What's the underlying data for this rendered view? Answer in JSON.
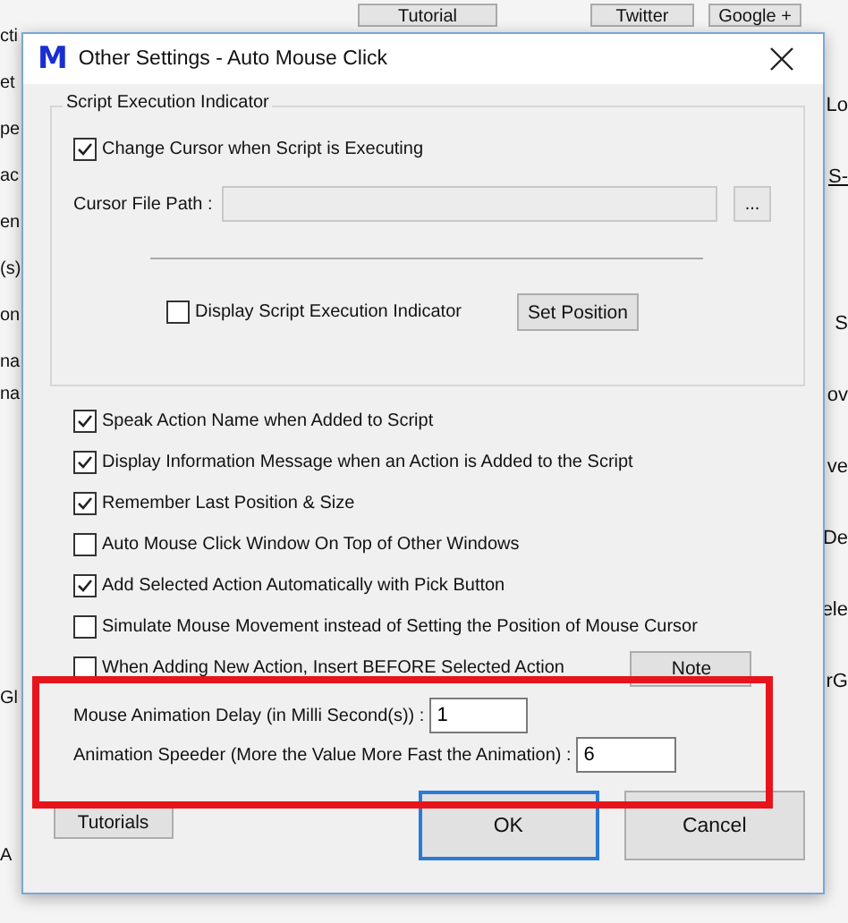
{
  "background": {
    "buttons": [
      "Tutorial",
      "Twitter",
      "Google +"
    ],
    "left_fragments": [
      "cti",
      "et",
      "pe",
      "ac",
      "en",
      "(s)",
      "on",
      "na",
      "na",
      "Gl",
      "A"
    ],
    "right_fragments": [
      "Lo",
      "S-",
      "S",
      "ov",
      "ve",
      "De",
      "ele",
      "rG"
    ]
  },
  "dialog": {
    "logo": "M",
    "title": "Other Settings - Auto Mouse Click",
    "group": {
      "title": "Script Execution Indicator",
      "change_cursor": {
        "label": "Change Cursor when Script is Executing",
        "checked": true
      },
      "cursor_path": {
        "label": "Cursor File Path :",
        "browse": "..."
      },
      "display_indicator": {
        "label": "Display Script Execution Indicator",
        "checked": false
      },
      "set_position": "Set Position"
    },
    "options": [
      {
        "label": "Speak Action Name when Added to Script",
        "checked": true
      },
      {
        "label": "Display Information Message when an Action is Added to the Script",
        "checked": true
      },
      {
        "label": "Remember Last Position & Size",
        "checked": true
      },
      {
        "label": "Auto Mouse Click Window On Top of Other Windows",
        "checked": false
      },
      {
        "label": "Add Selected Action Automatically with Pick Button",
        "checked": true
      },
      {
        "label": "Simulate Mouse Movement instead of Setting the Position of Mouse Cursor",
        "checked": false
      },
      {
        "label": "When Adding New Action, Insert BEFORE Selected Action",
        "checked": false
      }
    ],
    "note_button": "Note",
    "fields": [
      {
        "label": "Mouse Animation Delay (in Milli Second(s)) :",
        "value": "1"
      },
      {
        "label": "Animation Speeder (More the Value More Fast the Animation) :",
        "value": "6"
      }
    ],
    "buttons": [
      {
        "label": "Tutorials",
        "focused": false
      },
      {
        "label": "OK",
        "focused": true
      },
      {
        "label": "Cancel",
        "focused": false
      }
    ]
  }
}
